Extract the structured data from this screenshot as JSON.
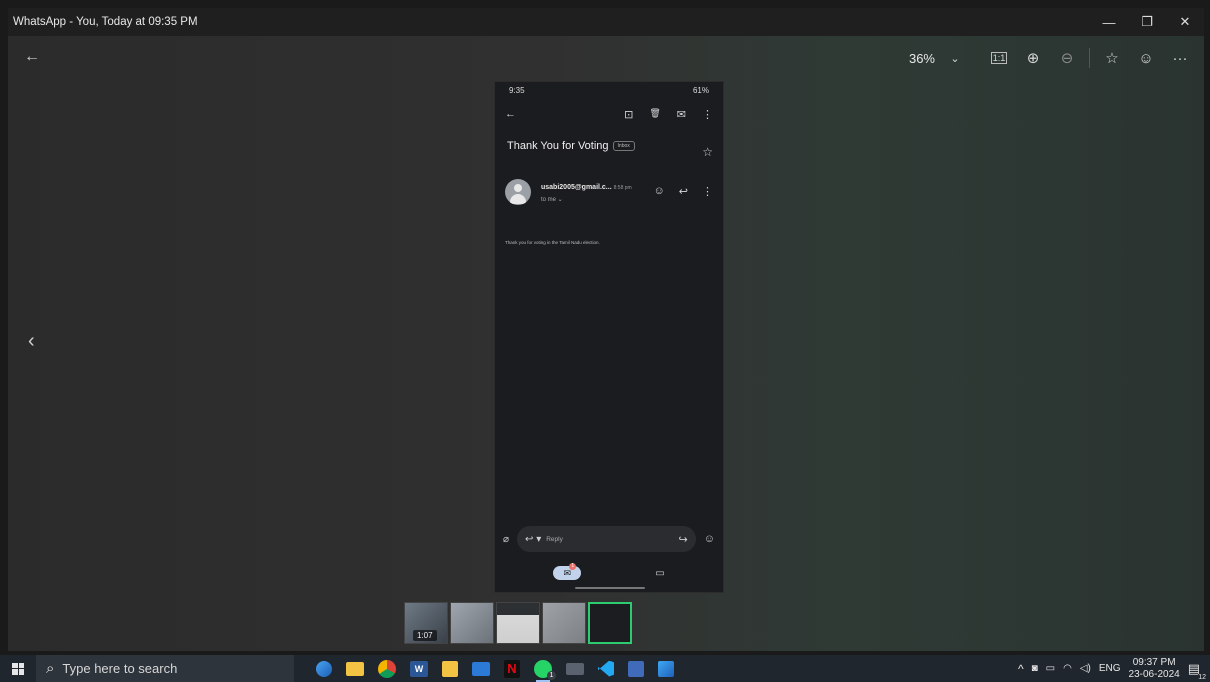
{
  "window": {
    "title": "WhatsApp - You, Today at 09:35 PM",
    "minimize_glyph": "—",
    "restore_glyph": "❐",
    "close_glyph": "✕"
  },
  "toolbar": {
    "back_glyph": "←",
    "zoom": "36%",
    "zoom_caret": "⌄",
    "actual_size_glyph": "1:1",
    "zoom_in_glyph": "⊕",
    "zoom_out_glyph": "⊖",
    "favorite_glyph": "☆",
    "react_glyph": "☺",
    "more_glyph": "···"
  },
  "nav": {
    "prev_glyph": "‹"
  },
  "phone": {
    "status_time": "9:35",
    "status_right": "61%",
    "back_glyph": "←",
    "action_glyphs": [
      "⊡",
      "🗑",
      "✉",
      "⋮"
    ],
    "subject": "Thank You for Voting",
    "label_chip": "Inbox",
    "star_glyph": "☆",
    "sender": "usabi2005@gmail.c...",
    "time": "8:58 pm",
    "to_me": "to me ⌄",
    "sender_action_glyphs": [
      "☺",
      "↩",
      "⋮"
    ],
    "body": "Thank you for voting in the Tamil Nadu election.",
    "reply_placeholder": "Reply",
    "attach_glyph": "⌀",
    "reply_glyph": "↩ ▾",
    "forward_glyph": "↪",
    "emoji_glyph": "☺",
    "mail_glyph": "✉",
    "mail_badge": "1",
    "meet_glyph": "▭"
  },
  "filmstrip": {
    "video_duration": "1:07"
  },
  "taskbar": {
    "search_placeholder": "Type here to search",
    "search_glyph": "⌕",
    "whatsapp_badge": "1",
    "tray_chevron": "^",
    "language": "ENG",
    "time": "09:37 PM",
    "date": "23-06-2024",
    "notification_count": "12"
  },
  "colors": {
    "taskbar_bg": "#20262e",
    "selected_thumb_border": "#2ecc71",
    "mail_pill": "#c2d2ea"
  }
}
